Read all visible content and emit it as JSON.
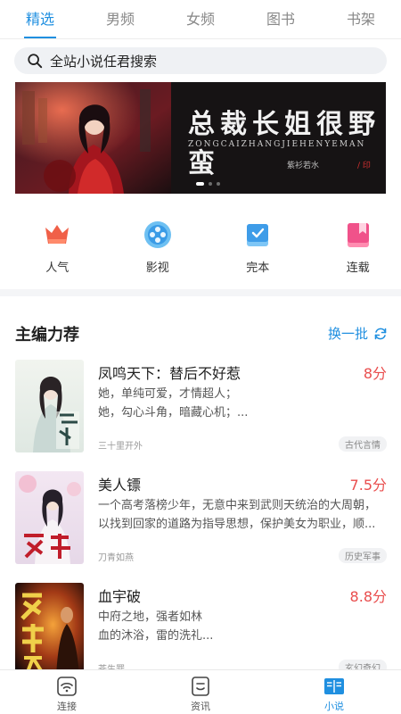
{
  "tabs": [
    {
      "label": "精选",
      "active": true
    },
    {
      "label": "男频"
    },
    {
      "label": "女频"
    },
    {
      "label": "图书"
    },
    {
      "label": "书架"
    }
  ],
  "search": {
    "placeholder": "全站小说任君搜索",
    "icon": "search-icon"
  },
  "banner": {
    "title": "总裁长姐很野蛮",
    "pinyin": "ZONGCAIZHANGJIEHENYEMAN",
    "author": "紫衫若水",
    "seal": "/ 印",
    "slides": 3,
    "active_slide": 0
  },
  "categories": [
    {
      "label": "人气",
      "icon": "crown-icon",
      "color": "#f06048"
    },
    {
      "label": "影视",
      "icon": "film-reel-icon",
      "color": "#4aa8ec"
    },
    {
      "label": "完本",
      "icon": "check-book-icon",
      "color": "#3e9ce8"
    },
    {
      "label": "连载",
      "icon": "bookmark-book-icon",
      "color": "#f0528a"
    }
  ],
  "section": {
    "title": "主编力荐",
    "refresh_label": "换一批",
    "refresh_icon": "refresh-icon"
  },
  "books": [
    {
      "title": "凤鸣天下：替后不好惹",
      "score": "8分",
      "desc": [
        "她，单纯可爱，才情超人；",
        "她，勾心斗角，暗藏心机；..."
      ],
      "author": "三十里开外",
      "tag": "古代言情"
    },
    {
      "title": "美人镖",
      "score": "7.5分",
      "desc": [
        "一个高考落榜少年，无意中来到武则天统治的大周朝，",
        "以找到回家的道路为指导思想，保护美女为职业，顺..."
      ],
      "author": "刀青如燕",
      "tag": "历史军事"
    },
    {
      "title": "血宇破",
      "score": "8.8分",
      "desc": [
        "中府之地，强者如林",
        "血的沐浴，雷的洗礼..."
      ],
      "author": "苍生罪",
      "tag": "玄幻奇幻"
    }
  ],
  "bottom_nav": [
    {
      "label": "连接",
      "icon": "wifi-icon"
    },
    {
      "label": "资讯",
      "icon": "news-icon"
    },
    {
      "label": "小说",
      "icon": "open-book-icon",
      "active": true
    }
  ],
  "colors": {
    "accent": "#1f8fe0",
    "score": "#e94d4d"
  }
}
